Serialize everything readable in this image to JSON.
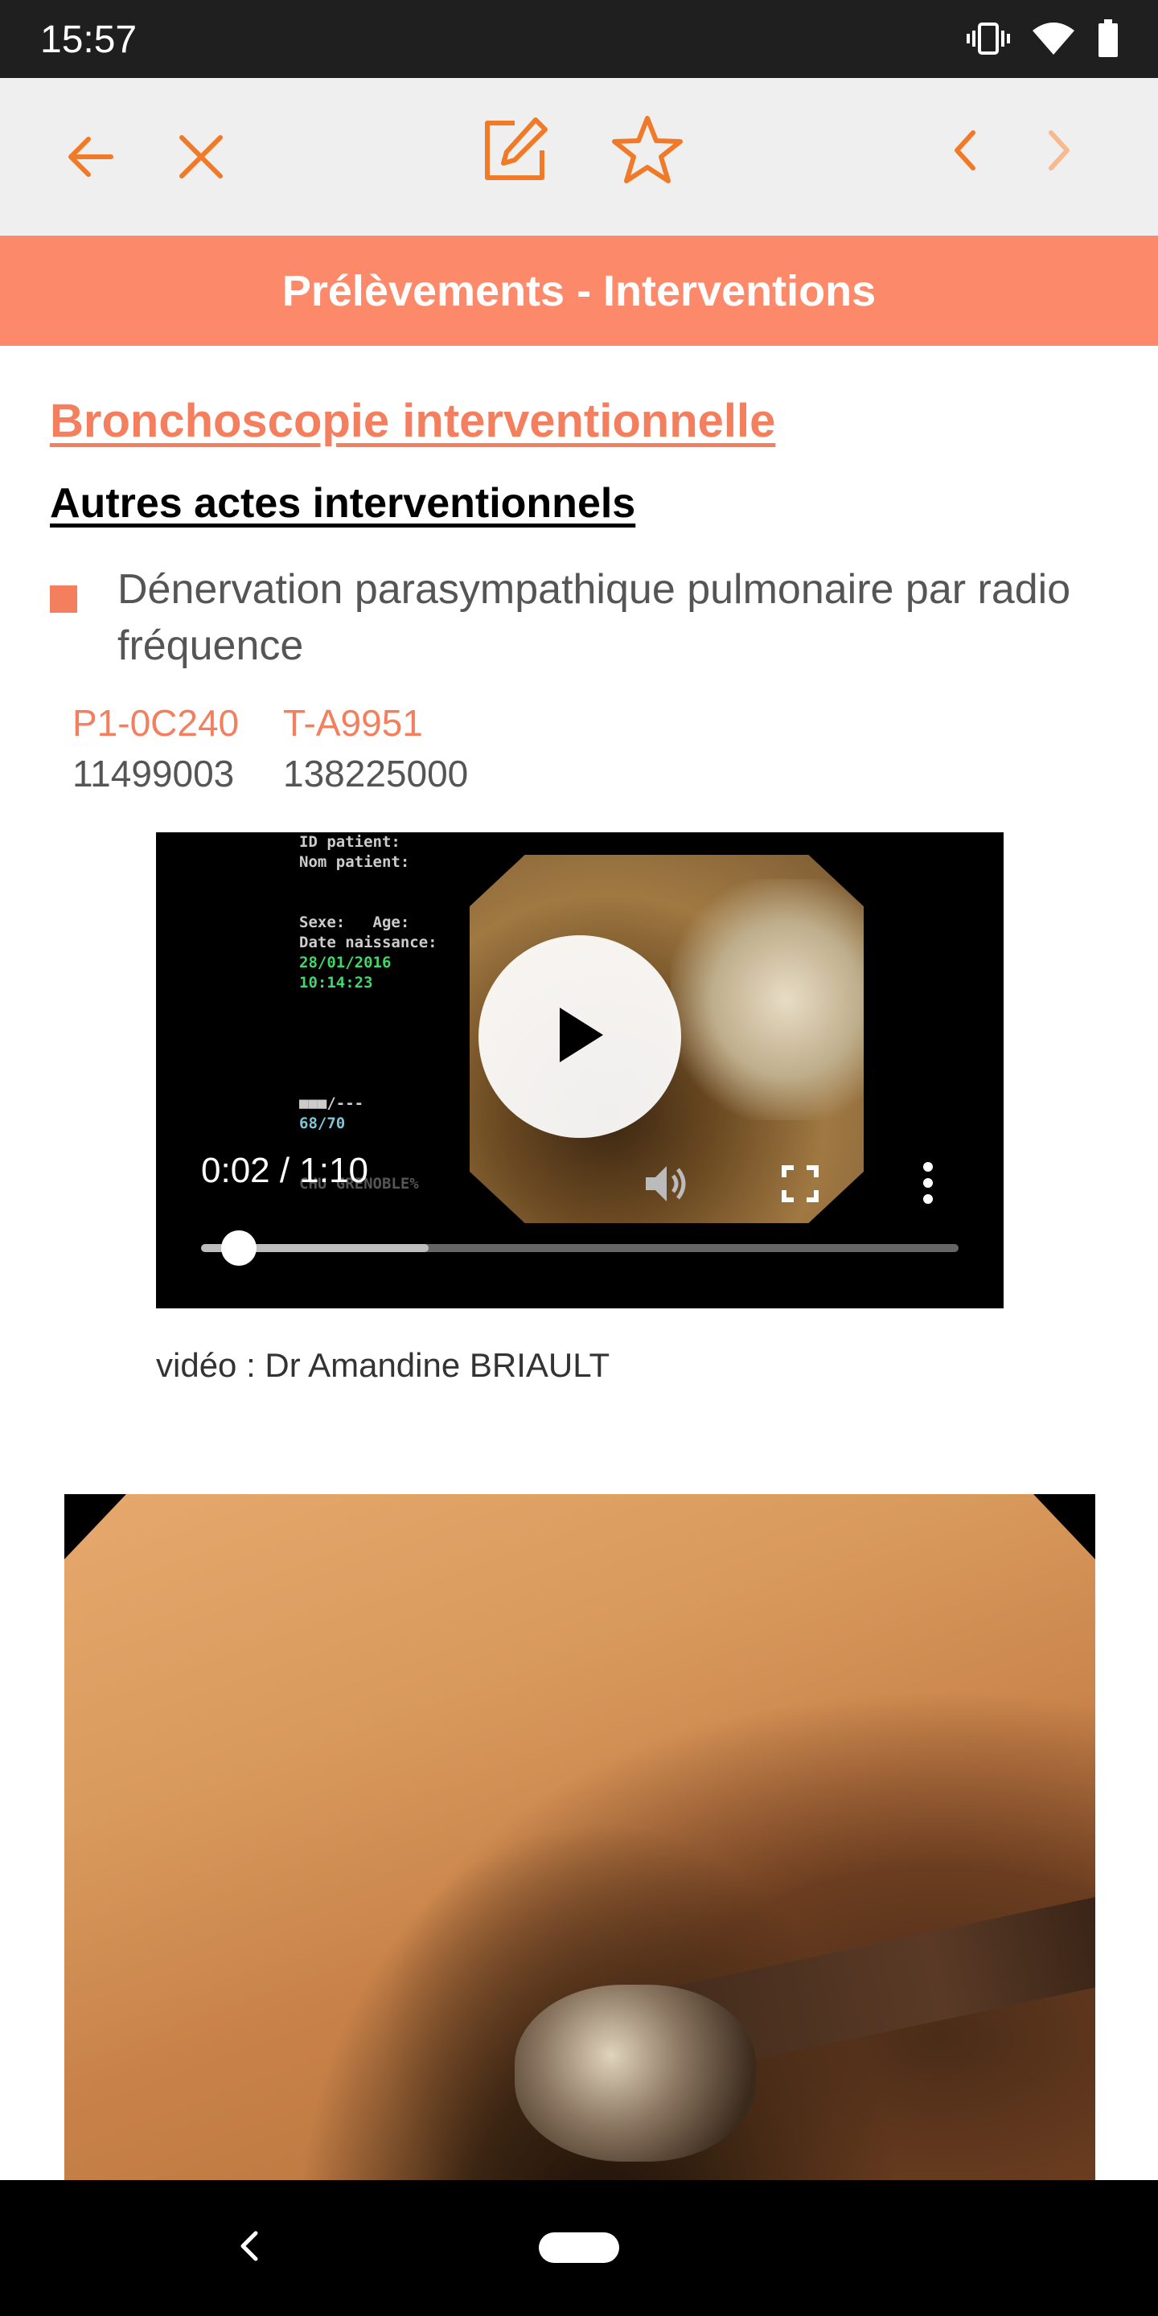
{
  "status_bar": {
    "time": "15:57",
    "icons": [
      "vibrate-icon",
      "wifi-icon",
      "battery-icon"
    ]
  },
  "toolbar": {
    "icons": [
      "back-arrow-icon",
      "close-icon",
      "edit-icon",
      "star-icon",
      "chevron-left-icon",
      "chevron-right-icon"
    ],
    "accent_color": "#f07a28",
    "disabled_color": "#f7b98f"
  },
  "section_header": {
    "title": "Prélèvements - Interventions",
    "color": "#fc8a6a"
  },
  "content": {
    "main_title": "Bronchoscopie interventionnelle",
    "sub_title": "Autres actes interventionnels",
    "bullet_text": "Dénervation parasympathique pulmonaire par radio fréquence",
    "codes": [
      {
        "label": "P1-0C240",
        "value": "11499003"
      },
      {
        "label": "T-A9951",
        "value": "138225000"
      }
    ]
  },
  "video_player": {
    "overlay_lines": [
      "ID patient:",
      "Nom patient:",
      "Sexe:   Age:",
      "Date naissance:",
      "28/01/2016",
      "10:14:23",
      "■■■/---",
      "68/70",
      "CHU GRENOBLE%"
    ],
    "time_display": "0:02 / 1:10",
    "progress_fraction": 0.05,
    "buffered_fraction": 0.3,
    "icons": [
      "play-icon",
      "volume-icon",
      "fullscreen-icon",
      "more-vert-icon"
    ]
  },
  "caption": "vidéo : Dr Amandine BRIAULT",
  "nav_bar": {
    "icons": [
      "nav-back-icon",
      "nav-home-pill"
    ]
  }
}
